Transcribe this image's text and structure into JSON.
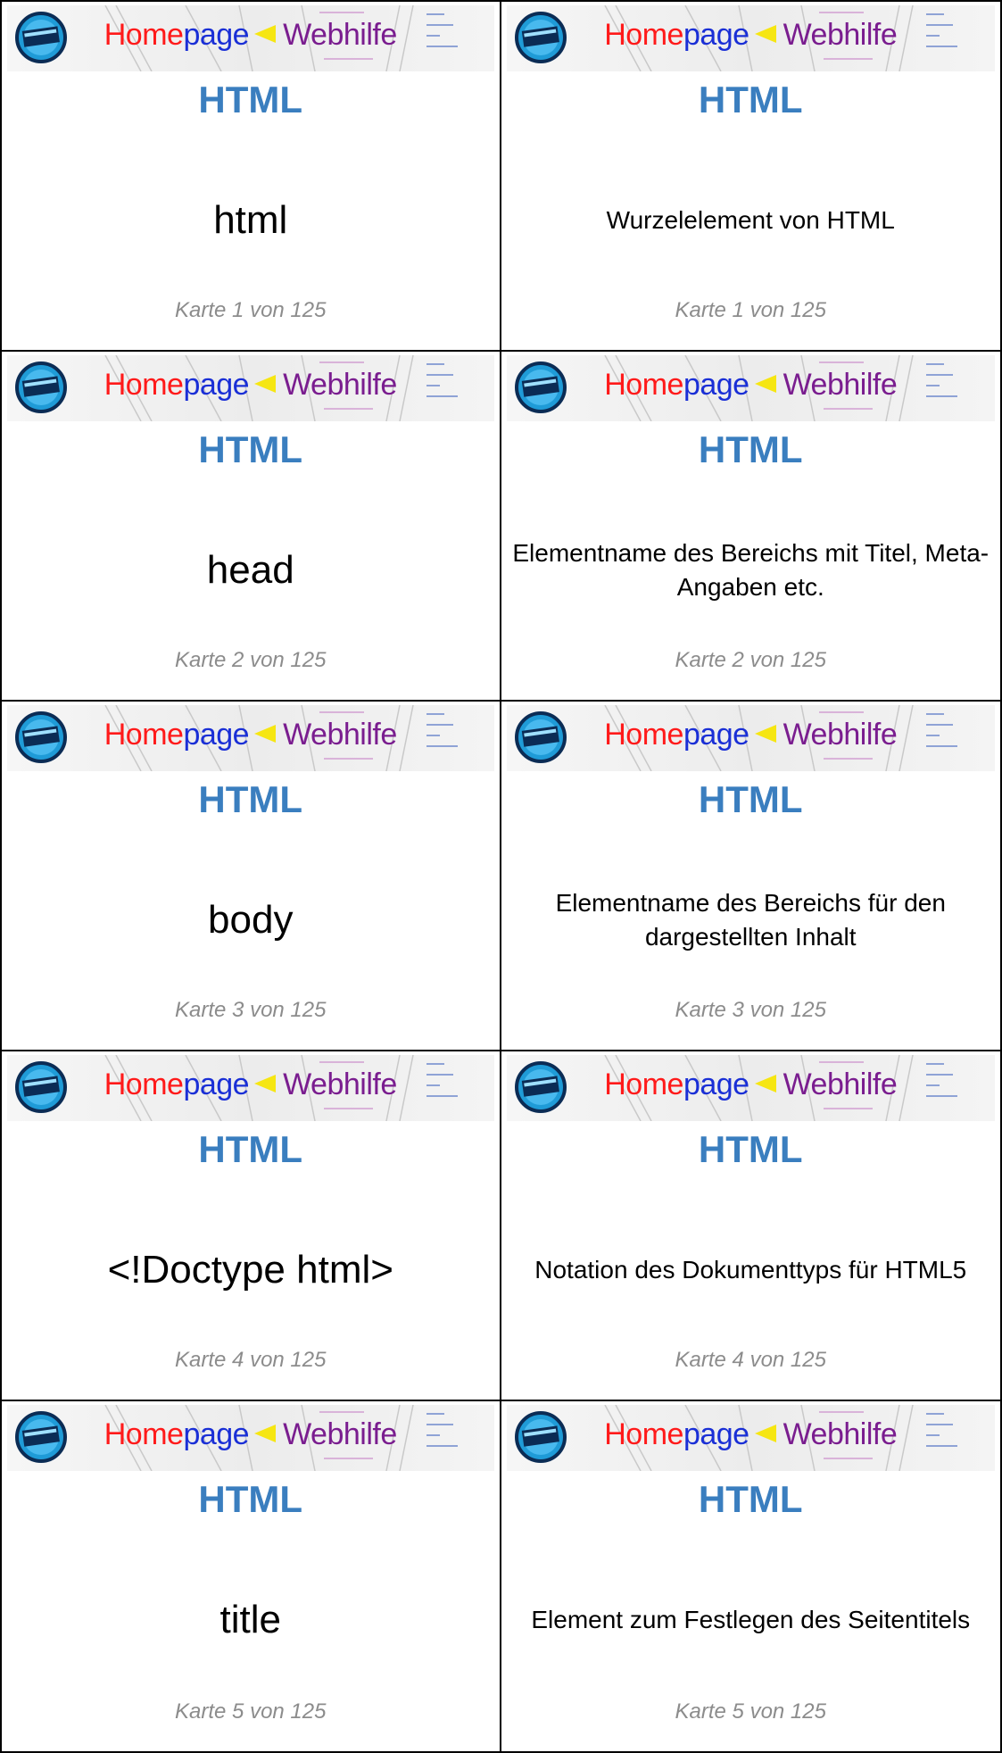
{
  "banner": {
    "part_home": "Home",
    "part_page": "page",
    "part_web": "Webhilfe",
    "logo_icon": "homepage-webhilfe-logo-icon"
  },
  "topic": "HTML",
  "cards": [
    {
      "side": "front",
      "text": "html",
      "footer": "Karte 1 von 125"
    },
    {
      "side": "back",
      "text": "Wurzelelement von HTML",
      "footer": "Karte 1 von 125"
    },
    {
      "side": "front",
      "text": "head",
      "footer": "Karte 2 von 125"
    },
    {
      "side": "back",
      "text": "Elementname des Bereichs mit Titel, Meta-Angaben etc.",
      "footer": "Karte 2 von 125"
    },
    {
      "side": "front",
      "text": "body",
      "footer": "Karte 3 von 125"
    },
    {
      "side": "back",
      "text": "Elementname des Bereichs für den dargestellten Inhalt",
      "footer": "Karte 3 von 125"
    },
    {
      "side": "front",
      "text": "<!Doctype html>",
      "footer": "Karte 4 von 125"
    },
    {
      "side": "back",
      "text": "Notation des Dokumenttyps für HTML5",
      "footer": "Karte 4 von 125"
    },
    {
      "side": "front",
      "text": "title",
      "footer": "Karte 5 von 125"
    },
    {
      "side": "back",
      "text": "Element zum Festlegen des Seitentitels",
      "footer": "Karte 5 von 125"
    }
  ]
}
